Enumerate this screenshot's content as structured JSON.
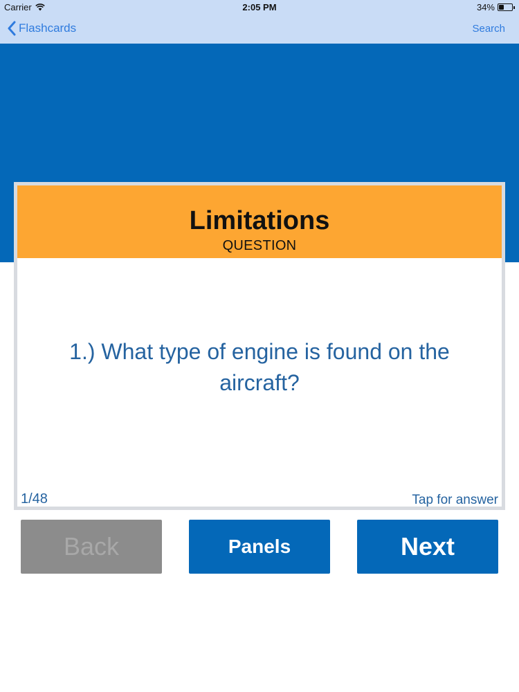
{
  "status_bar": {
    "carrier": "Carrier",
    "time": "2:05 PM",
    "battery_percent": "34%",
    "battery_level": 0.34,
    "wifi_icon": "wifi-icon"
  },
  "nav": {
    "back_label": "Flashcards",
    "search_label": "Search",
    "back_icon": "chevron-left-icon"
  },
  "card": {
    "category": "Limitations",
    "side": "QUESTION",
    "question": "1.) What type of engine is found on the aircraft?",
    "progress": "1/48",
    "tap_hint": "Tap for answer"
  },
  "buttons": {
    "back": "Back",
    "panels": "Panels",
    "next": "Next"
  },
  "colors": {
    "nav_background": "#c9dcf6",
    "primary_blue": "#0468b8",
    "card_header": "#fda632",
    "link_blue": "#2f7bde",
    "question_text": "#2563a0",
    "disabled_button": "#8c8c8c"
  }
}
